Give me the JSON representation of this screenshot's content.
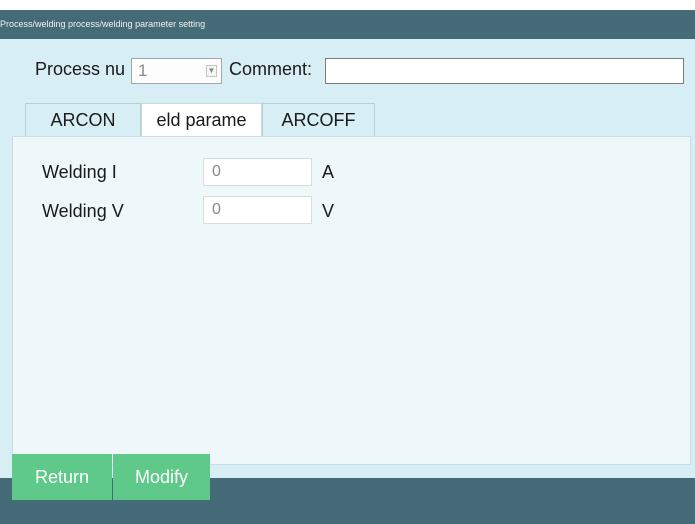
{
  "window": {
    "title": "Process/welding process/welding parameter setting"
  },
  "form": {
    "process_number_label": "Process nu",
    "process_number_value": "1",
    "comment_label": "Comment:",
    "comment_value": ""
  },
  "tabs": [
    {
      "label": "ARCON",
      "active": false
    },
    {
      "label": "eld parame",
      "active": true
    },
    {
      "label": "ARCOFF",
      "active": false
    }
  ],
  "params": [
    {
      "label": "Welding I",
      "value": "0",
      "unit": "A"
    },
    {
      "label": "Welding V",
      "value": "0",
      "unit": "V"
    }
  ],
  "buttons": {
    "return_label": "Return",
    "modify_label": "Modify"
  },
  "colors": {
    "titlebar": "#456b78",
    "background": "#d8eef5",
    "button": "#5fc98a"
  }
}
